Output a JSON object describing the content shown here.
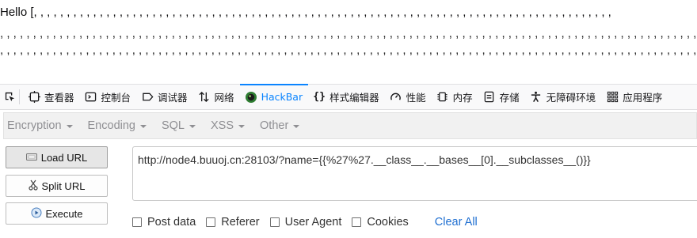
{
  "page": {
    "hello_line": "Hello [, , , , , , , , , , , , , , , , , , , , , , , , , , , , , , , , , , , , , , , , , , , , , , , , , , , , , , , , , , , , , , , , , , , , , , , , , , , , , , , , , , , , , , , ,",
    "comma_line_2": ", , , , , , , , , , , , , , , , , , , , , , , , , , , , , , , , , , , , , , , , , , , , , , , , , , , , , , , , , , , , , , , , , , , , , , , , , , , , , , , , , , , , , , , , , , , , , , , , , , , , , , , , , , , ,",
    "comma_line_3": ", , , , , , , , , , , , , , , , , , , , , , , , , , , , , , , , , , , , , , , , , , , , , , , , , , , , , , , , , , , , , , , , , , , , , , , , , , , , , , , , , , , , , , , , , , , , , , , , , , , , , , , , , , , ,"
  },
  "devtools": {
    "tabs": [
      {
        "label": "查看器",
        "icon": "inspector-icon"
      },
      {
        "label": "控制台",
        "icon": "console-icon"
      },
      {
        "label": "调试器",
        "icon": "debugger-icon"
      },
      {
        "label": "网络",
        "icon": "network-icon"
      },
      {
        "label": "HackBar",
        "icon": "hackbar-icon",
        "active": true
      },
      {
        "label": "样式编辑器",
        "icon": "style-editor-icon"
      },
      {
        "label": "性能",
        "icon": "performance-icon"
      },
      {
        "label": "内存",
        "icon": "memory-icon"
      },
      {
        "label": "存储",
        "icon": "storage-icon"
      },
      {
        "label": "无障碍环境",
        "icon": "accessibility-icon"
      },
      {
        "label": "应用程序",
        "icon": "application-icon"
      }
    ],
    "accent_color": "#0a84ff"
  },
  "hackbar": {
    "menus": [
      "Encryption",
      "Encoding",
      "SQL",
      "XSS",
      "Other"
    ],
    "buttons": {
      "load_url": "Load URL",
      "split_url": "Split URL",
      "execute": "Execute"
    },
    "url_value": "http://node4.buuoj.cn:28103/?name={{%27%27.__class__.__bases__[0].__subclasses__()}}",
    "options": {
      "post_data": "Post data",
      "referer": "Referer",
      "user_agent": "User Agent",
      "cookies": "Cookies"
    },
    "clear_all": "Clear All"
  }
}
